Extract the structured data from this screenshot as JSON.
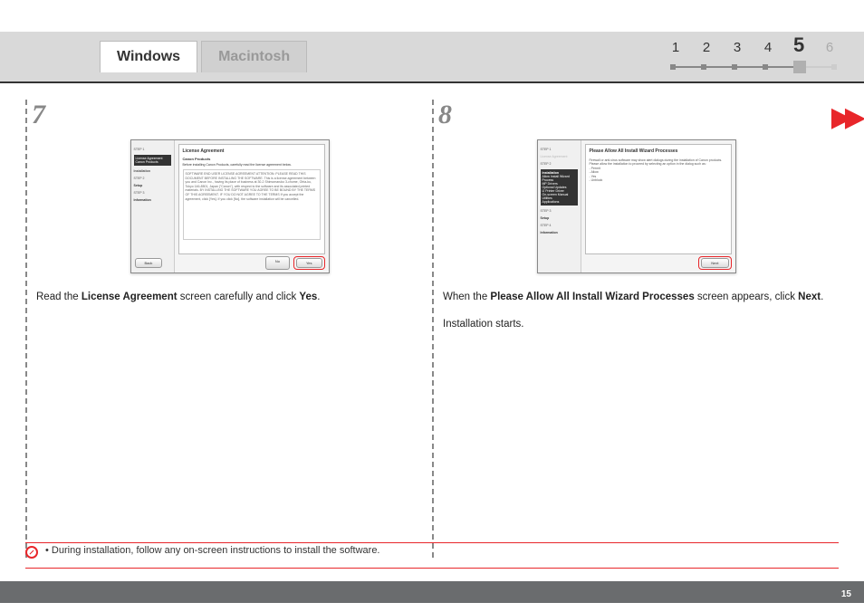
{
  "tabs": {
    "windows": "Windows",
    "macintosh": "Macintosh"
  },
  "stepbar": {
    "s1": "1",
    "s2": "2",
    "s3": "3",
    "s4": "4",
    "s5": "5",
    "s6": "6"
  },
  "step7": {
    "num": "7",
    "ss": {
      "side_hb": "License Agreement",
      "side_hb2": "Canon Products",
      "side_l1": "STEP 1",
      "side_l2": "Installation",
      "side_l3": "STEP 2",
      "side_l4": "Setup",
      "side_l5": "STEP 3",
      "side_l6": "Information",
      "title": "License Agreement",
      "subtitle": "Canon Products",
      "desc": "Before installing Canon Products, carefully read the license agreement below.",
      "body": "SOFTWARE END USER LICENSE AGREEMENT\nATTENTION: PLEASE READ THIS DOCUMENT BEFORE INSTALLING THE SOFTWARE.\nThis is a license agreement between you and Canon Inc., having its place of business at 30-2 Shimomaruko 3-chome, Ohta-ku, Tokyo 146-8501, Japan (\"Canon\"), with respect to the software and its associated printed materials.\nBY INSTALLING THE SOFTWARE YOU AGREE TO BE BOUND BY THE TERMS OF THIS AGREEMENT. IF YOU DO NOT AGREE TO THE TERMS\nIf you accept the agreement, click [Yes]. If you click [No], the software installation will be cancelled.",
      "btn_back": "Back",
      "btn_no": "No",
      "btn_yes": "Yes"
    },
    "caption_pre": "Read the ",
    "caption_bold": "License Agreement",
    "caption_mid": " screen carefully and click ",
    "caption_bold2": "Yes",
    "caption_end": "."
  },
  "step8": {
    "num": "8",
    "ss": {
      "side_l0": "STEP 1",
      "side_l0b": "License Agreement",
      "side_l1": "STEP 2",
      "side_hb": "Installation",
      "side_i1": "Allow Install Wizard Process",
      "side_i2": "MP Drivers",
      "side_i3": "Optional Updates",
      "side_i4": "IJ Printer Driver",
      "side_i5": "On-screen Manual",
      "side_i6": "Utilities",
      "side_i7": "Applications",
      "side_l3": "STEP 3",
      "side_l4": "Setup",
      "side_l5": "STEP 4",
      "side_l6": "Information",
      "title": "Please Allow All Install Wizard Processes",
      "body": "Firewall or anti-virus software may show alert dialogs during the installation of Canon products. Please allow the installation to proceed by selecting an option in the dialog such as:\n- Permit\n- Allow\n- Yes\n- Unblock",
      "btn_next": "Next"
    },
    "caption_pre": "When the ",
    "caption_bold": "Please Allow All Install Wizard Processes",
    "caption_mid": " screen appears, click ",
    "caption_bold2": "Next",
    "caption_end": ".",
    "sub": "Installation starts."
  },
  "note": {
    "text": "During installation, follow any on-screen instructions to install the software."
  },
  "page": "15",
  "arrows": "▶▶"
}
